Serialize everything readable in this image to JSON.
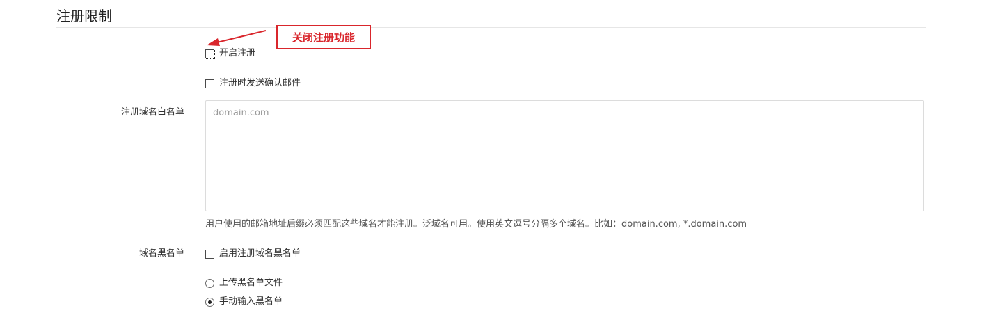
{
  "section": {
    "title": "注册限制"
  },
  "annotation": {
    "callout_text": "关闭注册功能",
    "color": "#d9262c"
  },
  "registration": {
    "enable_label": "开启注册",
    "enable_checked": false,
    "confirm_email_label": "注册时发送确认邮件",
    "confirm_email_checked": false
  },
  "whitelist": {
    "label": "注册域名白名单",
    "placeholder": "domain.com",
    "value": "",
    "help": "用户使用的邮箱地址后缀必须匹配这些域名才能注册。泛域名可用。使用英文逗号分隔多个域名。比如：domain.com, *.domain.com"
  },
  "blacklist": {
    "label": "域名黑名单",
    "enable_label": "启用注册域名黑名单",
    "enable_checked": false,
    "options": [
      {
        "label": "上传黑名单文件",
        "selected": false
      },
      {
        "label": "手动输入黑名单",
        "selected": true
      }
    ]
  }
}
